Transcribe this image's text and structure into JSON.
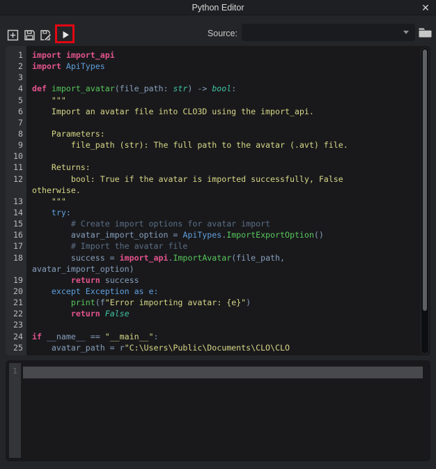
{
  "window": {
    "title": "Python Editor",
    "close_glyph": "✕"
  },
  "toolbar": {
    "source_label": "Source:",
    "source_value": "",
    "buttons": [
      {
        "name": "new-script-button",
        "icon": "plus-square-icon"
      },
      {
        "name": "save-button",
        "icon": "save-icon"
      },
      {
        "name": "save-as-button",
        "icon": "save-as-icon"
      },
      {
        "name": "run-button",
        "icon": "play-icon",
        "highlighted": true
      }
    ],
    "highlight_color": "#e30613"
  },
  "editor": {
    "rows": [
      {
        "n": "1",
        "s": [
          [
            "kw",
            "import"
          ],
          [
            "id",
            " "
          ],
          [
            "kw",
            "import_api"
          ]
        ]
      },
      {
        "n": "2",
        "s": [
          [
            "kw",
            "import"
          ],
          [
            "id",
            " "
          ],
          [
            "blu",
            "ApiTypes"
          ]
        ]
      },
      {
        "n": "3",
        "s": []
      },
      {
        "n": "4",
        "s": [
          [
            "kw",
            "def"
          ],
          [
            "id",
            " "
          ],
          [
            "fn",
            "import_avatar"
          ],
          [
            "id",
            "(file_path: "
          ],
          [
            "typ",
            "str"
          ],
          [
            "id",
            ") -> "
          ],
          [
            "typ",
            "bool"
          ],
          [
            "id",
            ":"
          ]
        ]
      },
      {
        "n": "5",
        "s": [
          [
            "str",
            "    \"\"\""
          ]
        ]
      },
      {
        "n": "6",
        "s": [
          [
            "str",
            "    Import an avatar file into CLO3D using the import_api."
          ]
        ]
      },
      {
        "n": "7",
        "s": []
      },
      {
        "n": "8",
        "s": [
          [
            "str",
            "    Parameters:"
          ]
        ]
      },
      {
        "n": "9",
        "s": [
          [
            "str",
            "        file_path (str): The full path to the avatar (.avt) file."
          ]
        ]
      },
      {
        "n": "10",
        "s": []
      },
      {
        "n": "11",
        "s": [
          [
            "str",
            "    Returns:"
          ]
        ]
      },
      {
        "n": "12",
        "s": [
          [
            "str",
            "        bool: True if the avatar is imported successfully, False"
          ]
        ]
      },
      {
        "n": "",
        "s": [
          [
            "str",
            "otherwise."
          ]
        ]
      },
      {
        "n": "13",
        "s": [
          [
            "str",
            "    \"\"\""
          ]
        ]
      },
      {
        "n": "14",
        "s": [
          [
            "blu",
            "    try:"
          ]
        ]
      },
      {
        "n": "15",
        "s": [
          [
            "com",
            "        # Create import options for avatar import"
          ]
        ]
      },
      {
        "n": "16",
        "s": [
          [
            "id",
            "        avatar_import_option = "
          ],
          [
            "blu",
            "ApiTypes"
          ],
          [
            "id",
            "."
          ],
          [
            "fn",
            "ImportExportOption"
          ],
          [
            "id",
            "()"
          ]
        ]
      },
      {
        "n": "17",
        "s": [
          [
            "com",
            "        # Import the avatar file"
          ]
        ]
      },
      {
        "n": "18",
        "s": [
          [
            "id",
            "        success = "
          ],
          [
            "kw",
            "import_api"
          ],
          [
            "id",
            "."
          ],
          [
            "fn",
            "ImportAvatar"
          ],
          [
            "id",
            "(file_path,"
          ]
        ]
      },
      {
        "n": "",
        "s": [
          [
            "id",
            "avatar_import_option)"
          ]
        ]
      },
      {
        "n": "19",
        "s": [
          [
            "id",
            "        "
          ],
          [
            "kw",
            "return"
          ],
          [
            "id",
            " success"
          ]
        ]
      },
      {
        "n": "20",
        "s": [
          [
            "blu",
            "    except Exception as e:"
          ]
        ]
      },
      {
        "n": "21",
        "s": [
          [
            "id",
            "        "
          ],
          [
            "fn",
            "print"
          ],
          [
            "id",
            "(f"
          ],
          [
            "str",
            "\"Error importing avatar: {e}\""
          ],
          [
            "id",
            ")"
          ]
        ]
      },
      {
        "n": "22",
        "s": [
          [
            "id",
            "        "
          ],
          [
            "kw",
            "return"
          ],
          [
            "id",
            " "
          ],
          [
            "typ",
            "False"
          ]
        ]
      },
      {
        "n": "23",
        "s": []
      },
      {
        "n": "24",
        "s": [
          [
            "kw",
            "if"
          ],
          [
            "id",
            " __name__ == "
          ],
          [
            "str",
            "\"__main__\""
          ],
          [
            "id",
            ":"
          ]
        ]
      },
      {
        "n": "25",
        "s": [
          [
            "id",
            "    avatar_path = r"
          ],
          [
            "str",
            "\"C:\\Users\\Public\\Documents\\CLO\\CLO"
          ]
        ]
      }
    ]
  },
  "console": {
    "first_line_number": "1"
  }
}
